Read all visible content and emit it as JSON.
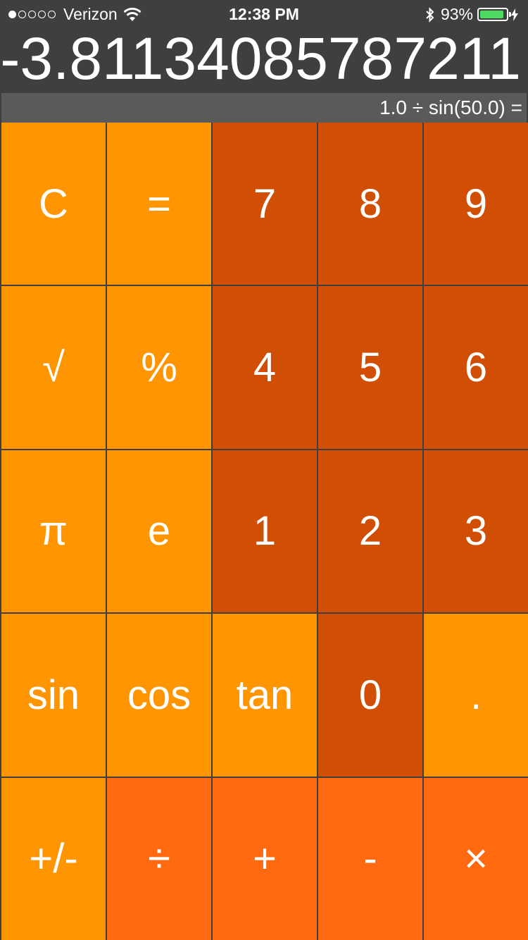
{
  "status_bar": {
    "carrier": "Verizon",
    "time": "12:38 PM",
    "battery": "93%",
    "battery_level": 0.93,
    "colors": {
      "battery_fill": "#4cd964"
    }
  },
  "display": {
    "result": "-3.81134085787211",
    "expression": "1.0 ÷ sin(50.0) ="
  },
  "keys": {
    "row1": [
      "C",
      "=",
      "7",
      "8",
      "9"
    ],
    "row2": [
      "√",
      "%",
      "4",
      "5",
      "6"
    ],
    "row3": [
      "π",
      "e",
      "1",
      "2",
      "3"
    ],
    "row4": [
      "sin",
      "cos",
      "tan",
      "0",
      "."
    ],
    "row5": [
      "+/-",
      "÷",
      "+",
      "-",
      "×"
    ]
  },
  "colors": {
    "function_key": "#ff9500",
    "number_key": "#d04f05",
    "operator_key": "#ff6a10",
    "background": "#3f3f3f"
  }
}
